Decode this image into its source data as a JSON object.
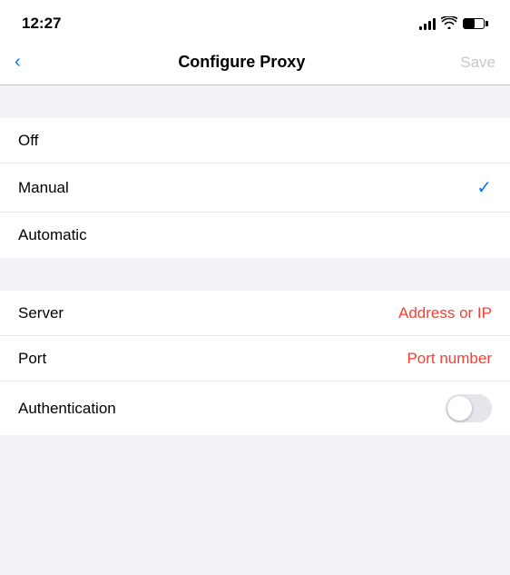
{
  "statusBar": {
    "time": "12:27"
  },
  "navBar": {
    "backLabel": "‹",
    "title": "Configure Proxy",
    "saveLabel": "Save"
  },
  "proxyOptions": [
    {
      "id": "off",
      "label": "Off",
      "selected": false
    },
    {
      "id": "manual",
      "label": "Manual",
      "selected": true
    },
    {
      "id": "automatic",
      "label": "Automatic",
      "selected": false
    }
  ],
  "serverSection": {
    "serverLabel": "Server",
    "serverPlaceholder": "Address or IP",
    "portLabel": "Port",
    "portPlaceholder": "Port number",
    "authLabel": "Authentication"
  },
  "colors": {
    "checkBlue": "#007aff",
    "placeholderRed": "#ff3b30",
    "saveDimmed": "#c7c7cc"
  }
}
